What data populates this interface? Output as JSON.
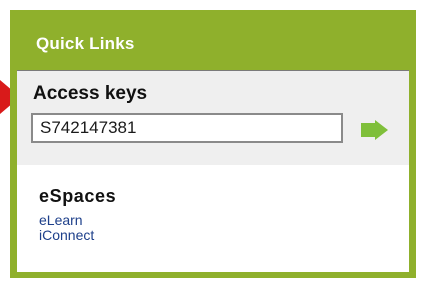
{
  "quick_links": {
    "title": "Quick Links",
    "access_keys": {
      "title": "Access keys",
      "input_value": "S742147381"
    },
    "espaces": {
      "title": "eSpaces",
      "links": [
        "eLearn",
        "iConnect"
      ]
    }
  },
  "colors": {
    "panel_green": "#8fb02c",
    "go_arrow_green": "#7fbf3a",
    "pointer_arrow_red": "#d91a1a",
    "link_blue": "#1d3f8a"
  },
  "icons": {
    "go": "right-arrow-icon",
    "pointer": "red-pointer-arrow-icon"
  }
}
